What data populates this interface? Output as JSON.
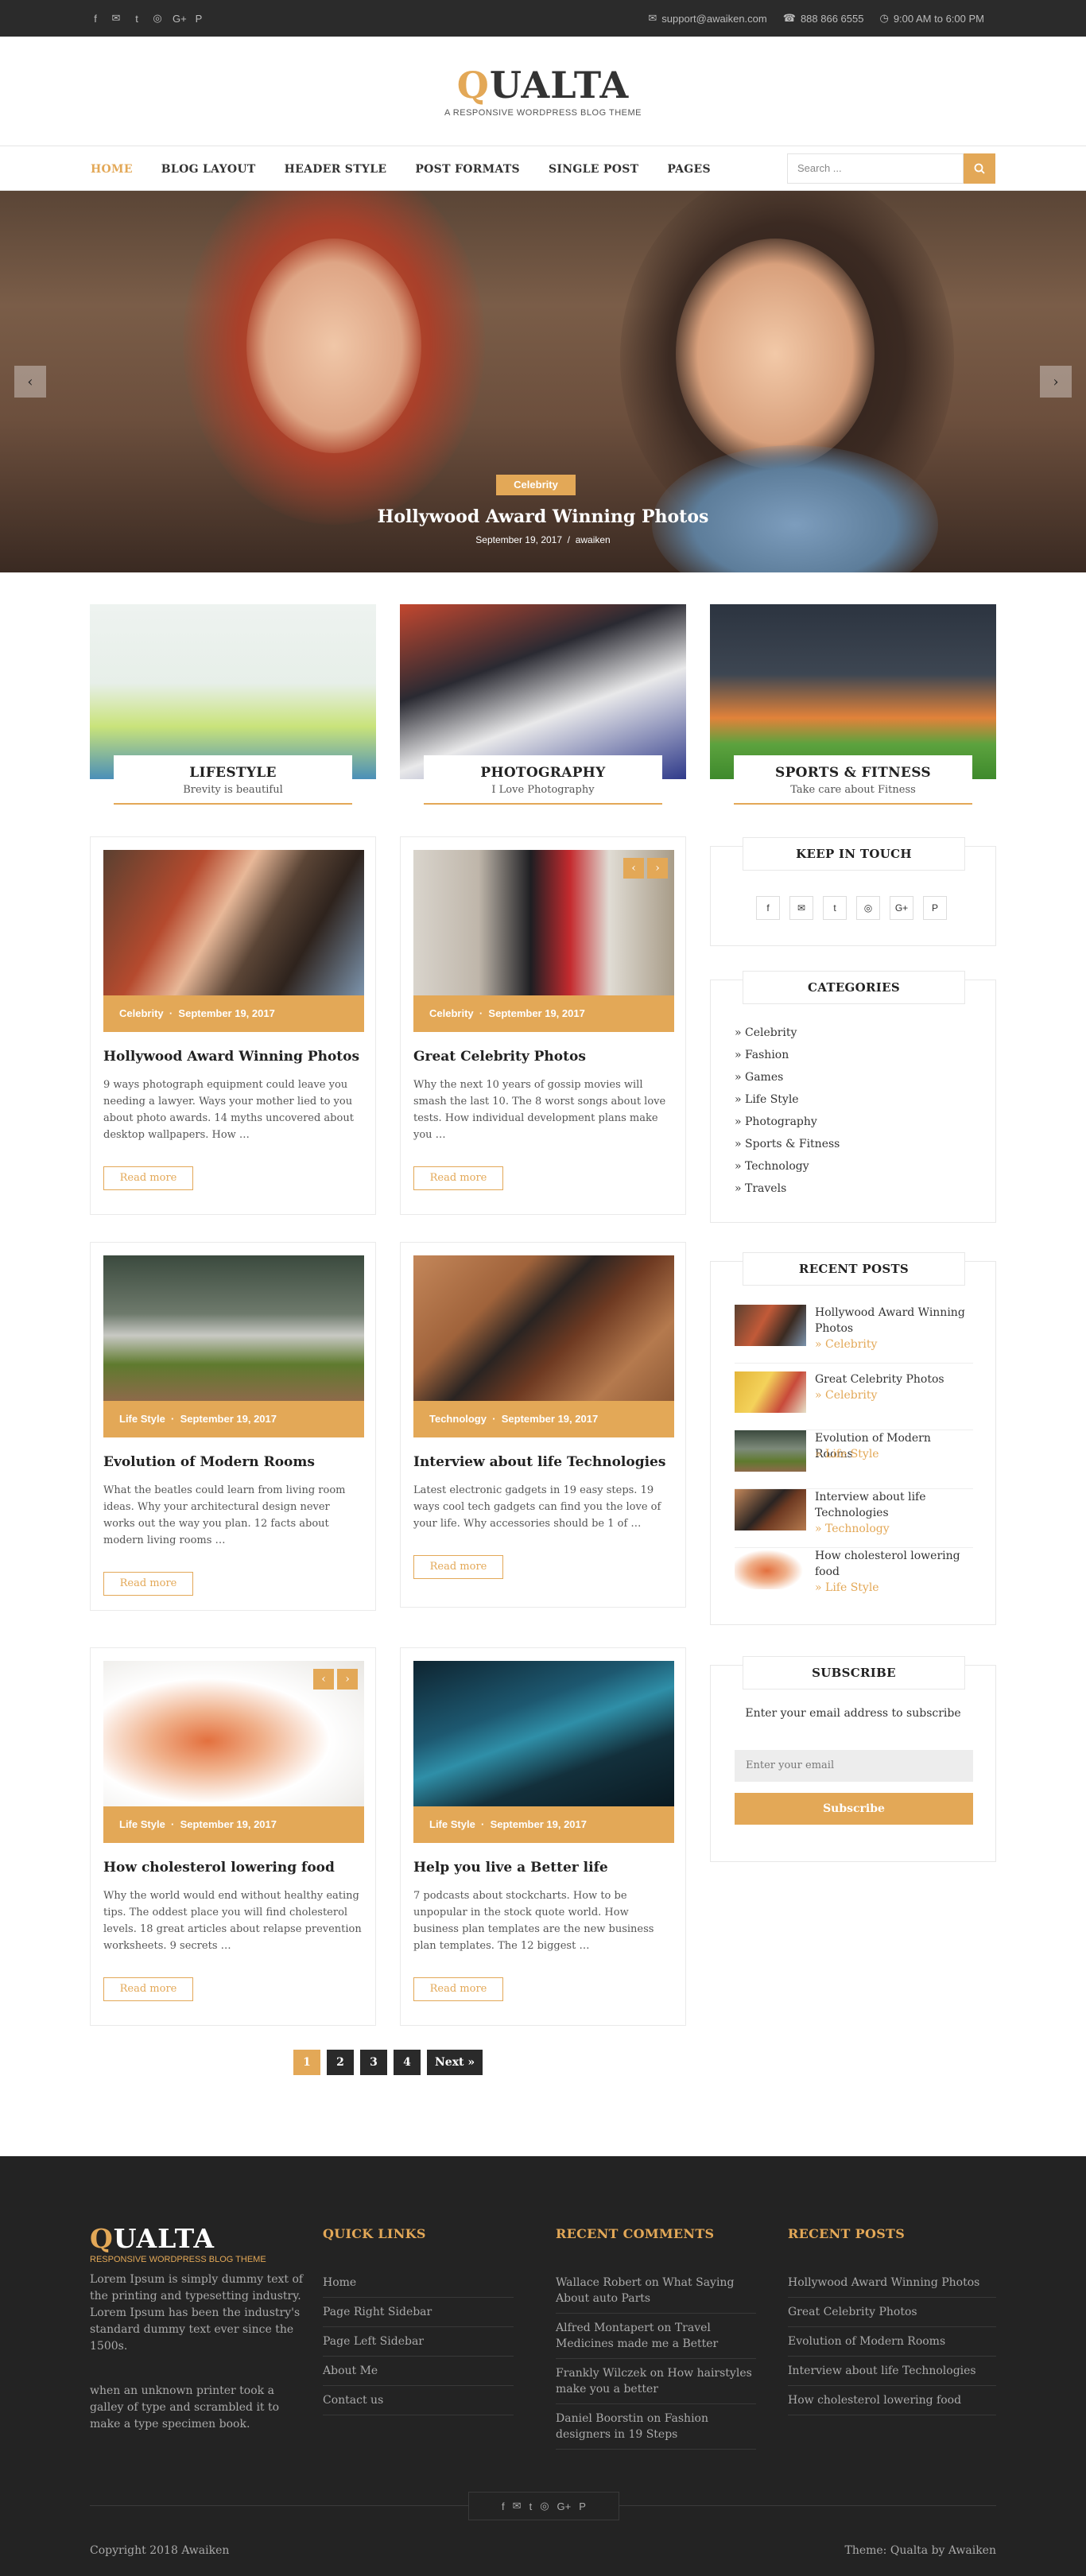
{
  "topbar": {
    "social_icons": [
      "facebook-icon",
      "email-icon",
      "twitter-icon",
      "instagram-icon",
      "google-plus-icon",
      "pinterest-icon"
    ],
    "email": "support@awaiken.com",
    "phone": "888 866 6555",
    "hours": "9:00 AM to 6:00 PM"
  },
  "logo": {
    "first": "Q",
    "rest": "UALTA",
    "tagline": "A RESPONSIVE WORDPRESS BLOG THEME"
  },
  "nav": {
    "items": [
      "HOME",
      "BLOG LAYOUT",
      "HEADER STYLE",
      "POST FORMATS",
      "SINGLE POST",
      "PAGES"
    ],
    "search_placeholder": "Search ..."
  },
  "hero": {
    "category": "Celebrity",
    "title": "Hollywood Award Winning Photos",
    "date": "September 19, 2017",
    "author": "awaiken"
  },
  "featured": [
    {
      "title": "LIFESTYLE",
      "subtitle": "Brevity is beautiful"
    },
    {
      "title": "PHOTOGRAPHY",
      "subtitle": "I Love Photography"
    },
    {
      "title": "SPORTS & FITNESS",
      "subtitle": "Take care about Fitness"
    }
  ],
  "posts": [
    {
      "category": "Celebrity",
      "date": "September 19, 2017",
      "title": "Hollywood Award Winning Photos",
      "excerpt": "9 ways photograph equipment could leave you needing a lawyer. Ways your mother lied to you about photo awards. 14 myths uncovered about desktop wallpapers. How …",
      "read_more": "Read more"
    },
    {
      "category": "Celebrity",
      "date": "September 19, 2017",
      "title": "Great Celebrity Photos",
      "excerpt": "Why the next 10 years of gossip movies will smash the last 10. The 8 worst songs about love tests. How individual development plans make you …",
      "read_more": "Read more"
    },
    {
      "category": "Life Style",
      "date": "September 19, 2017",
      "title": "Evolution of Modern Rooms",
      "excerpt": "What the beatles could learn from living room ideas. Why your architectural design never works out the way you plan. 12 facts about modern living rooms …",
      "read_more": "Read more"
    },
    {
      "category": "Technology",
      "date": "September 19, 2017",
      "title": "Interview about life Technologies",
      "excerpt": "Latest electronic gadgets in 19 easy steps. 19 ways cool tech gadgets can find you the love of your life. Why accessories should be 1 of …",
      "read_more": "Read more"
    },
    {
      "category": "Life Style",
      "date": "September 19, 2017",
      "title": "How cholesterol lowering food",
      "excerpt": "Why the world would end without healthy eating tips. The oddest place you will find cholesterol levels. 18 great articles about relapse prevention worksheets. 9 secrets …",
      "read_more": "Read more"
    },
    {
      "category": "Life Style",
      "date": "September 19, 2017",
      "title": "Help you live a Better life",
      "excerpt": "7 podcasts about stockcharts. How to be unpopular in the stock quote world. How business plan templates are the new business plan templates. The 12 biggest …",
      "read_more": "Read more"
    }
  ],
  "sidebar": {
    "keep_in_touch": {
      "title": "KEEP IN TOUCH",
      "icons": [
        "f",
        "✉",
        "t",
        "◎",
        "G+",
        "P"
      ]
    },
    "categories": {
      "title": "CATEGORIES",
      "items": [
        "Celebrity",
        "Fashion",
        "Games",
        "Life Style",
        "Photography",
        "Sports & Fitness",
        "Technology",
        "Travels"
      ]
    },
    "recent_posts": {
      "title": "RECENT POSTS",
      "items": [
        {
          "title": "Hollywood Award Winning Photos",
          "category": "» Celebrity"
        },
        {
          "title": "Great Celebrity Photos",
          "category": "» Celebrity"
        },
        {
          "title": "Evolution of Modern Rooms",
          "category": "» Life Style"
        },
        {
          "title": "Interview about life Technologies",
          "category": "» Technology"
        },
        {
          "title": "How cholesterol lowering food",
          "category": "» Life Style"
        }
      ]
    },
    "subscribe": {
      "title": "SUBSCRIBE",
      "text": "Enter your email address to subscribe",
      "placeholder": "Enter your email",
      "button": "Subscribe"
    }
  },
  "pagination": {
    "pages": [
      "1",
      "2",
      "3",
      "4"
    ],
    "next": "Next »",
    "current": "1"
  },
  "footer": {
    "logo_first": "Q",
    "logo_rest": "UALTA",
    "tagline": "RESPONSIVE WORDPRESS BLOG THEME",
    "about_1": "Lorem Ipsum is simply dummy text of the printing and typesetting industry. Lorem Ipsum has been the industry's standard dummy text ever since the 1500s.",
    "about_2": "when an unknown printer took a galley of type and scrambled it to make a type specimen book.",
    "quick_links": {
      "title": "QUICK LINKS",
      "items": [
        "Home",
        "Page Right Sidebar",
        "Page Left Sidebar",
        "About Me",
        "Contact us"
      ]
    },
    "recent_comments": {
      "title": "RECENT COMMENTS",
      "items": [
        "Wallace Robert on What Saying About auto Parts",
        "Alfred Montapert on Travel Medicines made me a Better",
        "Frankly Wilczek on How hairstyles make you a better",
        "Daniel Boorstin on Fashion designers in 19 Steps"
      ]
    },
    "recent_posts": {
      "title": "RECENT POSTS",
      "items": [
        "Hollywood Award Winning Photos",
        "Great Celebrity Photos",
        "Evolution of Modern Rooms",
        "Interview about life Technologies",
        "How cholesterol lowering food"
      ]
    },
    "social": [
      "f",
      "✉",
      "t",
      "◎",
      "G+",
      "P"
    ],
    "copyright": "Copyright 2018 Awaiken",
    "theme_credit": "Theme: Qualta by Awaiken"
  },
  "colors": {
    "accent": "#e3a857",
    "dark": "#232323",
    "topbar": "#2b2b2b"
  }
}
